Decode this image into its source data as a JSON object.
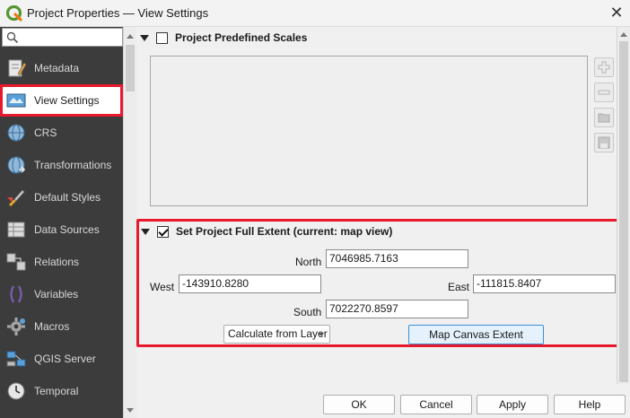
{
  "window": {
    "title": "Project Properties — View Settings",
    "close_glyph": "✕"
  },
  "search": {
    "placeholder": ""
  },
  "sidebar": {
    "items": [
      {
        "label": "Metadata",
        "icon": "metadata-icon"
      },
      {
        "label": "View Settings",
        "icon": "view-settings-icon",
        "selected": true
      },
      {
        "label": "CRS",
        "icon": "globe-icon"
      },
      {
        "label": "Transformations",
        "icon": "transformations-icon"
      },
      {
        "label": "Default Styles",
        "icon": "paintbrush-icon"
      },
      {
        "label": "Data Sources",
        "icon": "data-sources-icon"
      },
      {
        "label": "Relations",
        "icon": "relations-icon"
      },
      {
        "label": "Variables",
        "icon": "variables-icon"
      },
      {
        "label": "Macros",
        "icon": "gear-icon"
      },
      {
        "label": "QGIS Server",
        "icon": "server-icon"
      },
      {
        "label": "Temporal",
        "icon": "clock-icon"
      }
    ]
  },
  "scales_section": {
    "label": "Project Predefined Scales",
    "checked": false,
    "side_buttons": [
      "add-scale",
      "remove-scale",
      "import-scales",
      "save-scales"
    ]
  },
  "extent_section": {
    "label": "Set Project Full Extent (current: map view)",
    "checked": true,
    "north_label": "North",
    "north_value": "7046985.7163",
    "west_label": "West",
    "west_value": "-143910.8280",
    "east_label": "East",
    "east_value": "-111815.8407",
    "south_label": "South",
    "south_value": "7022270.8597",
    "calculate_label": "Calculate from Layer",
    "map_canvas_label": "Map Canvas Extent"
  },
  "dialog_buttons": {
    "ok": "OK",
    "cancel": "Cancel",
    "apply": "Apply",
    "help": "Help"
  },
  "colors": {
    "highlight": "#e8192c",
    "sidebar_bg": "#3c3c3c",
    "accent_blue": "#3c8fd6"
  }
}
